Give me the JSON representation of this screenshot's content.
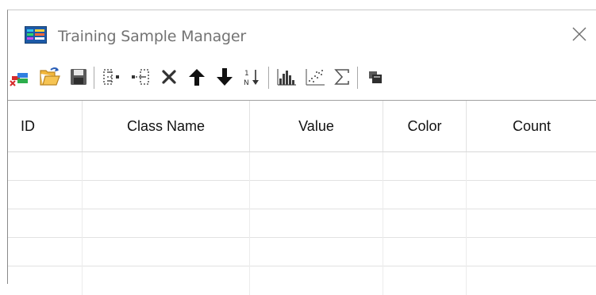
{
  "window": {
    "title": "Training Sample Manager",
    "close_icon": "close-icon"
  },
  "toolbar": {
    "icons": [
      "new-class-icon",
      "open-folder-icon",
      "save-icon",
      "merge-classes-icon",
      "split-class-icon",
      "delete-icon",
      "move-up-icon",
      "move-down-icon",
      "sort-icon",
      "histogram-icon",
      "scatterplot-icon",
      "statistics-sigma-icon",
      "export-icon"
    ]
  },
  "table": {
    "columns": [
      "ID",
      "Class Name",
      "Value",
      "Color",
      "Count"
    ],
    "rows": []
  }
}
